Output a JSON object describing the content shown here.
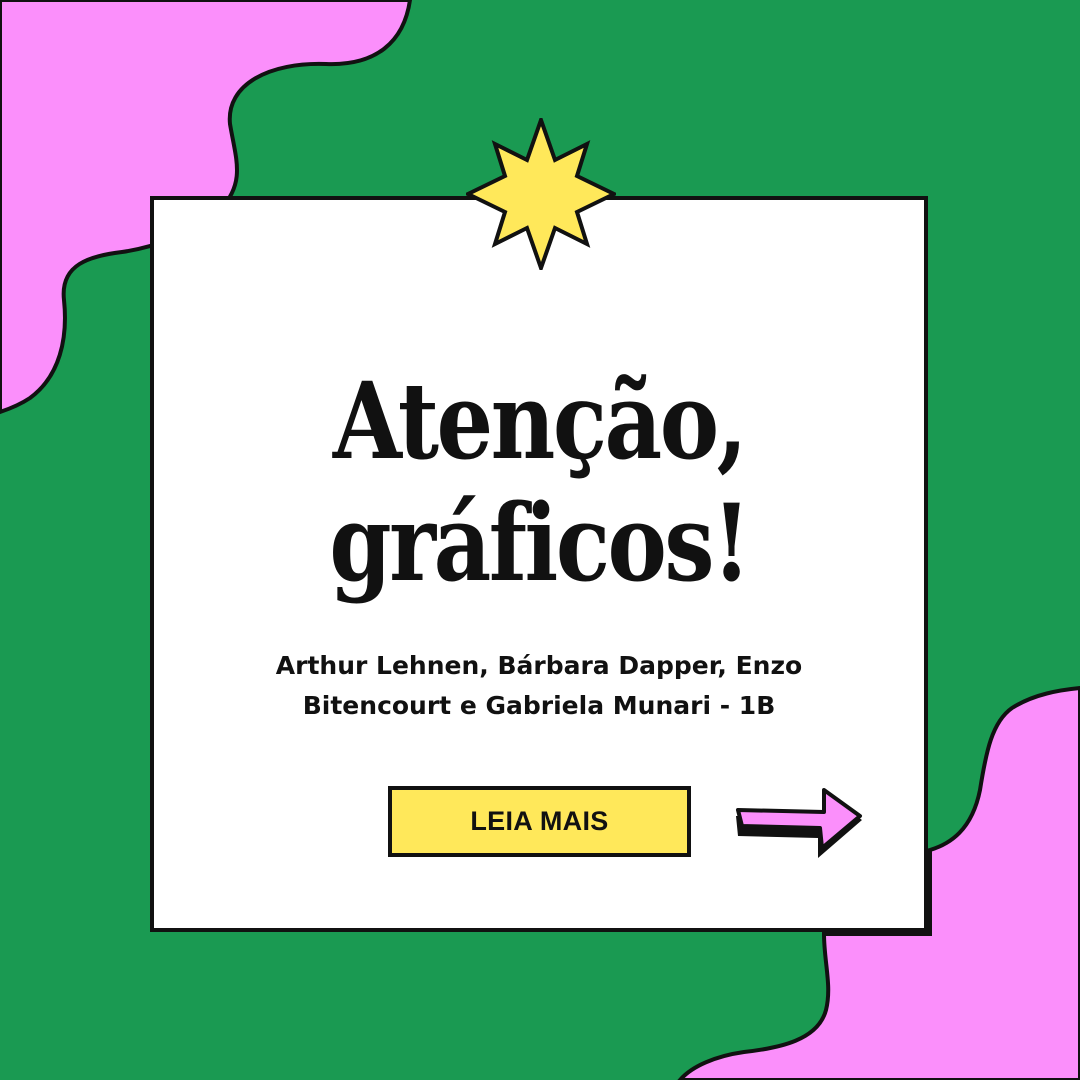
{
  "headline": {
    "line1": "Atenção,",
    "line2": "gráficos!"
  },
  "authors": {
    "line1": "Arthur Lehnen, Bárbara Dapper, Enzo",
    "line2": "Bitencourt e Gabriela Munari - 1B"
  },
  "cta": {
    "label": "LEIA MAIS"
  },
  "icons": {
    "star": "eight-point-star-icon",
    "arrow": "arrow-right-icon"
  },
  "colors": {
    "background_green": "#1a9a52",
    "blob_pink": "#fb8ffb",
    "card_white": "#ffffff",
    "accent_yellow": "#ffe85a",
    "outline_black": "#111111"
  }
}
